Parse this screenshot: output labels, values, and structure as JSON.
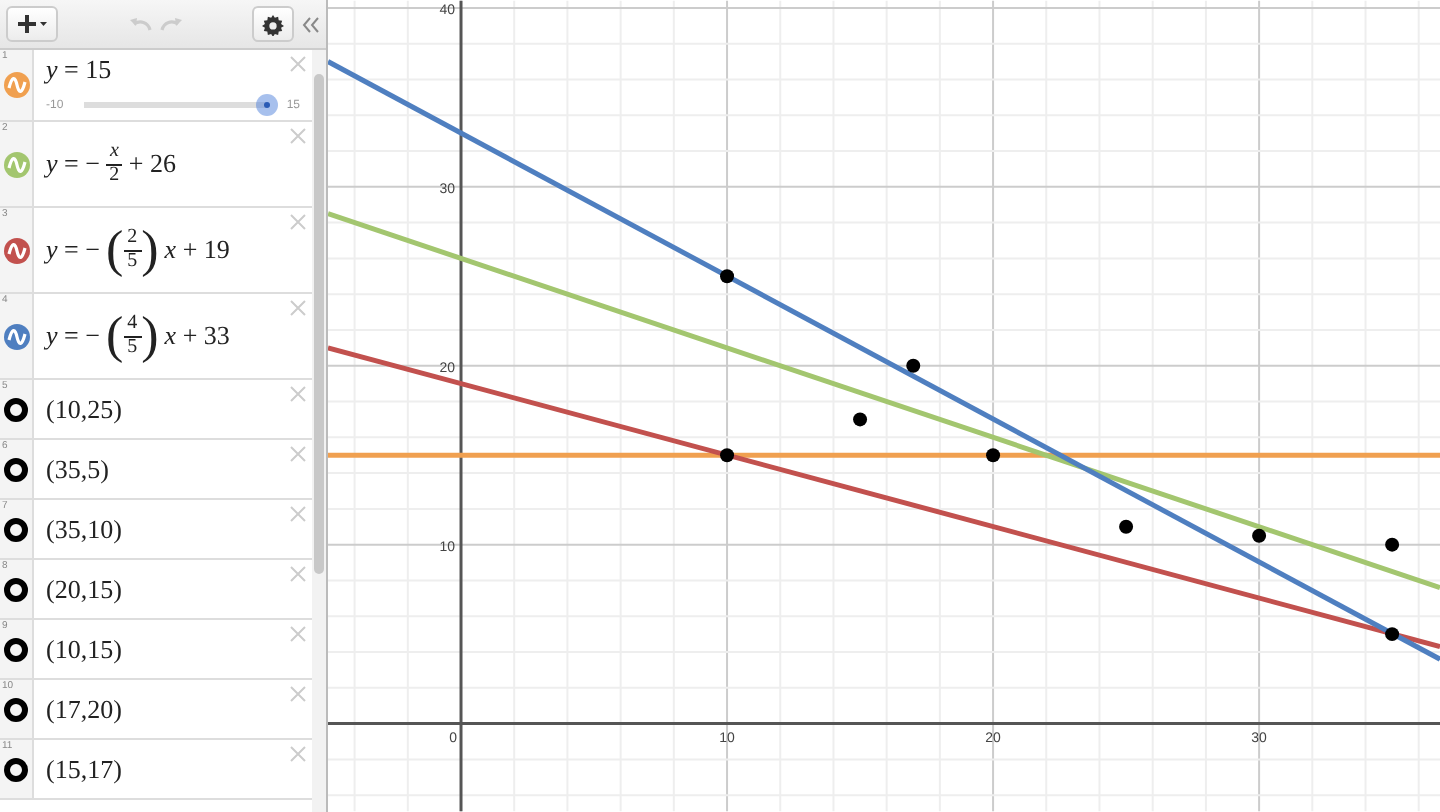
{
  "expressions": [
    {
      "index": "1",
      "kind": "curve",
      "color": "#f0a050",
      "parts": [
        {
          "kind": "text",
          "text": "*y* = 15"
        }
      ],
      "slider": {
        "min": "-10",
        "max": "15",
        "level": 1.0
      }
    },
    {
      "index": "2",
      "kind": "curve",
      "color": "#a3c66f",
      "parts": [
        {
          "kind": "text",
          "text": "*y* = −"
        },
        {
          "kind": "fraction",
          "num": "*x*",
          "den": "2"
        },
        {
          "kind": "text",
          "text": "+ 26"
        }
      ]
    },
    {
      "index": "3",
      "kind": "curve",
      "color": "#c2514e",
      "parts": [
        {
          "kind": "text",
          "text": "*y* = −"
        },
        {
          "kind": "paren_fraction",
          "open": "(",
          "num": "2",
          "den": "5",
          "close": ")"
        },
        {
          "kind": "text",
          "text": "*x* + 19"
        }
      ]
    },
    {
      "index": "4",
      "kind": "curve",
      "color": "#4f7fc0",
      "parts": [
        {
          "kind": "text",
          "text": "*y* = −"
        },
        {
          "kind": "paren_fraction",
          "open": "(",
          "num": "4",
          "den": "5",
          "close": ")"
        },
        {
          "kind": "text",
          "text": "*x* + 33"
        }
      ]
    },
    {
      "index": "5",
      "kind": "point",
      "parts": [
        {
          "kind": "text",
          "text": "(10,25)"
        }
      ]
    },
    {
      "index": "6",
      "kind": "point",
      "parts": [
        {
          "kind": "text",
          "text": "(35,5)"
        }
      ]
    },
    {
      "index": "7",
      "kind": "point",
      "parts": [
        {
          "kind": "text",
          "text": "(35,10)"
        }
      ]
    },
    {
      "index": "8",
      "kind": "point",
      "parts": [
        {
          "kind": "text",
          "text": "(20,15)"
        }
      ]
    },
    {
      "index": "9",
      "kind": "point",
      "parts": [
        {
          "kind": "text",
          "text": "(10,15)"
        }
      ]
    },
    {
      "index": "10",
      "kind": "point",
      "parts": [
        {
          "kind": "text",
          "text": "(17,20)"
        }
      ]
    },
    {
      "index": "11",
      "kind": "point",
      "parts": [
        {
          "kind": "text",
          "text": "(15,17)"
        }
      ]
    }
  ],
  "graph": {
    "chart_data": {
      "type": "line",
      "grid": true,
      "xlim": [
        -5,
        36.8
      ],
      "ylim": [
        -4.9,
        40.4
      ],
      "xticks": [
        0,
        10,
        20,
        30
      ],
      "yticks": [
        10,
        20,
        30,
        40
      ],
      "series": [
        {
          "type": "line",
          "color": "#f0a050",
          "x": [
            -5,
            36.8
          ],
          "values": [
            15,
            15
          ]
        },
        {
          "type": "line",
          "color": "#a3c66f",
          "x": [
            -5,
            36.8
          ],
          "values": [
            28.5,
            7.6
          ]
        },
        {
          "type": "line",
          "color": "#c2514e",
          "x": [
            -5,
            36.8
          ],
          "values": [
            21,
            4.3
          ]
        },
        {
          "type": "line",
          "color": "#4f7fc0",
          "x": [
            -5,
            36.8
          ],
          "values": [
            37,
            3.6
          ]
        },
        {
          "type": "scatter",
          "color": "#000000",
          "x": [
            10,
            17,
            15,
            20,
            10,
            25,
            30,
            35,
            35
          ],
          "values": [
            25,
            20,
            17,
            15,
            15,
            11,
            10.5,
            10,
            5
          ]
        }
      ]
    }
  }
}
